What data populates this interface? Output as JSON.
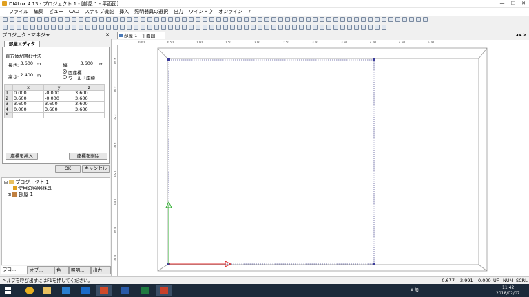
{
  "window": {
    "title": "DIALux 4.13 - プロジェクト 1 - [部屋 1 - 平面図]",
    "minimize_glyph": "—",
    "restore_glyph": "❐",
    "close_glyph": "✕"
  },
  "menu": [
    "ファイル",
    "編集",
    "ビュー",
    "CAD",
    "スナップ機能",
    "挿入",
    "照明器具の選択",
    "出力",
    "ウインドウ",
    "オンライン",
    "?"
  ],
  "left_panel": {
    "header": "プロジェクトマネジャ",
    "close_glyph": "✕",
    "editor_tab": "部屋エディタ",
    "section_title": "直方体が囲む寸法",
    "length_label": "長さ:",
    "length_value": "3.600",
    "length_unit": "m",
    "width_label": "幅:",
    "width_value": "3.600",
    "width_unit": "m",
    "height_label": "高さ:",
    "height_value": "2.400",
    "height_unit": "m",
    "radio_face": "面座標",
    "radio_world": "ワールド座標",
    "table": {
      "headers": [
        "x",
        "y",
        "z"
      ],
      "rows": [
        {
          "n": "1",
          "x": "0.000",
          "y": "-0.000",
          "z": "3.600"
        },
        {
          "n": "2",
          "x": "3.600",
          "y": "-0.000",
          "z": "3.600"
        },
        {
          "n": "3",
          "x": "3.600",
          "y": "3.600",
          "z": "3.600"
        },
        {
          "n": "4",
          "x": "0.000",
          "y": "3.600",
          "z": "3.600"
        }
      ],
      "new_row_marker": "*"
    },
    "insert_button": "座標を挿入",
    "delete_button": "座標を削除",
    "ok_button": "OK",
    "cancel_button": "キャンセル"
  },
  "tree": {
    "project": "プロジェクト 1",
    "luminaires": "使用の照明器具",
    "room": "部屋 1"
  },
  "bottom_tabs": [
    "プロ...",
    "オブ...",
    "色",
    "照明...",
    "出力"
  ],
  "document": {
    "tab_label": "部屋 1 - 平面図",
    "nav_glyph": "◂ ▸ ✕",
    "h_ticks": [
      "0.00",
      "0.50",
      "1.00",
      "1.50",
      "2.00",
      "2.50",
      "3.00",
      "3.50",
      "4.00",
      "4.50",
      "5.00"
    ],
    "v_ticks": [
      "3.50",
      "3.00",
      "2.50",
      "2.00",
      "1.50",
      "1.00",
      "0.50",
      "0.00"
    ]
  },
  "status_bar": {
    "help": "ヘルプを呼び出すにはF1を押してください。",
    "x": "-0.677",
    "y": "2.991",
    "z": "0.000",
    "uf": "UF",
    "num": "NUM",
    "scrl": "SCRL"
  },
  "taskbar": {
    "ime": "A 般",
    "time": "11:42",
    "date": "2018/02/07",
    "icons": [
      "start-icon",
      "chrome-icon",
      "explorer-icon",
      "store-icon",
      "outlook-icon",
      "powerpoint-icon",
      "word-icon",
      "excel-icon",
      "dialux-icon"
    ]
  },
  "colors": {
    "x_axis": "#e03030",
    "y_axis": "#30b030",
    "room_outline": "#5a5a9a",
    "vertex": "#3a3a9a"
  }
}
